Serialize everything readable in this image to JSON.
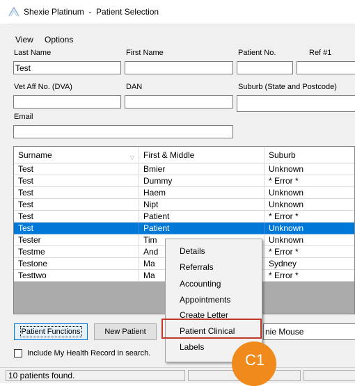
{
  "window": {
    "title": "Shexie Platinum  -  Patient Selection"
  },
  "menu": [
    "View",
    "Options"
  ],
  "fields": {
    "last_name": {
      "label": "Last Name",
      "value": "Test"
    },
    "first_name": {
      "label": "First Name",
      "value": ""
    },
    "patient_no": {
      "label": "Patient No.",
      "value": ""
    },
    "ref1": {
      "label": "Ref #1",
      "value": ""
    },
    "vet_aff": {
      "label": "Vet Aff No. (DVA)",
      "value": ""
    },
    "dan": {
      "label": "DAN",
      "value": ""
    },
    "suburb": {
      "label": "Suburb (State and Postcode)",
      "value": ""
    },
    "email": {
      "label": "Email",
      "value": ""
    }
  },
  "grid": {
    "columns": [
      "Surname",
      "First & Middle",
      "Suburb"
    ],
    "rows": [
      [
        "Test",
        "Bmier",
        "Unknown"
      ],
      [
        "Test",
        "Dummy",
        "* Error *"
      ],
      [
        "Test",
        "Haem",
        "Unknown"
      ],
      [
        "Test",
        "Nipt",
        "Unknown"
      ],
      [
        "Test",
        "Patient",
        "* Error *"
      ],
      [
        "Test",
        "Patient",
        "Unknown"
      ],
      [
        "Tester",
        "Tim",
        "Unknown"
      ],
      [
        "Testme",
        "And",
        "* Error *"
      ],
      [
        "Testone",
        "Ma",
        "Sydney"
      ],
      [
        "Testtwo",
        "Ma",
        "* Error *"
      ]
    ],
    "selected_row": 5
  },
  "buttons": {
    "patient_functions": "Patient Functions",
    "new_patient": "New Patient",
    "user_field": "nie Mouse"
  },
  "checkbox": {
    "label": "Include My Health Record in search.",
    "checked": false
  },
  "status": {
    "text": "10 patients found."
  },
  "context_menu": {
    "items": [
      "Details",
      "Referrals",
      "Accounting",
      "Appointments",
      "Create Letter",
      "Patient Clinical",
      "Labels"
    ],
    "highlighted": "Patient Clinical"
  },
  "callout": {
    "label": "C1",
    "color": "#f08a1c"
  },
  "colors": {
    "selection": "#0078d7",
    "highlight_box": "#c0392b"
  }
}
